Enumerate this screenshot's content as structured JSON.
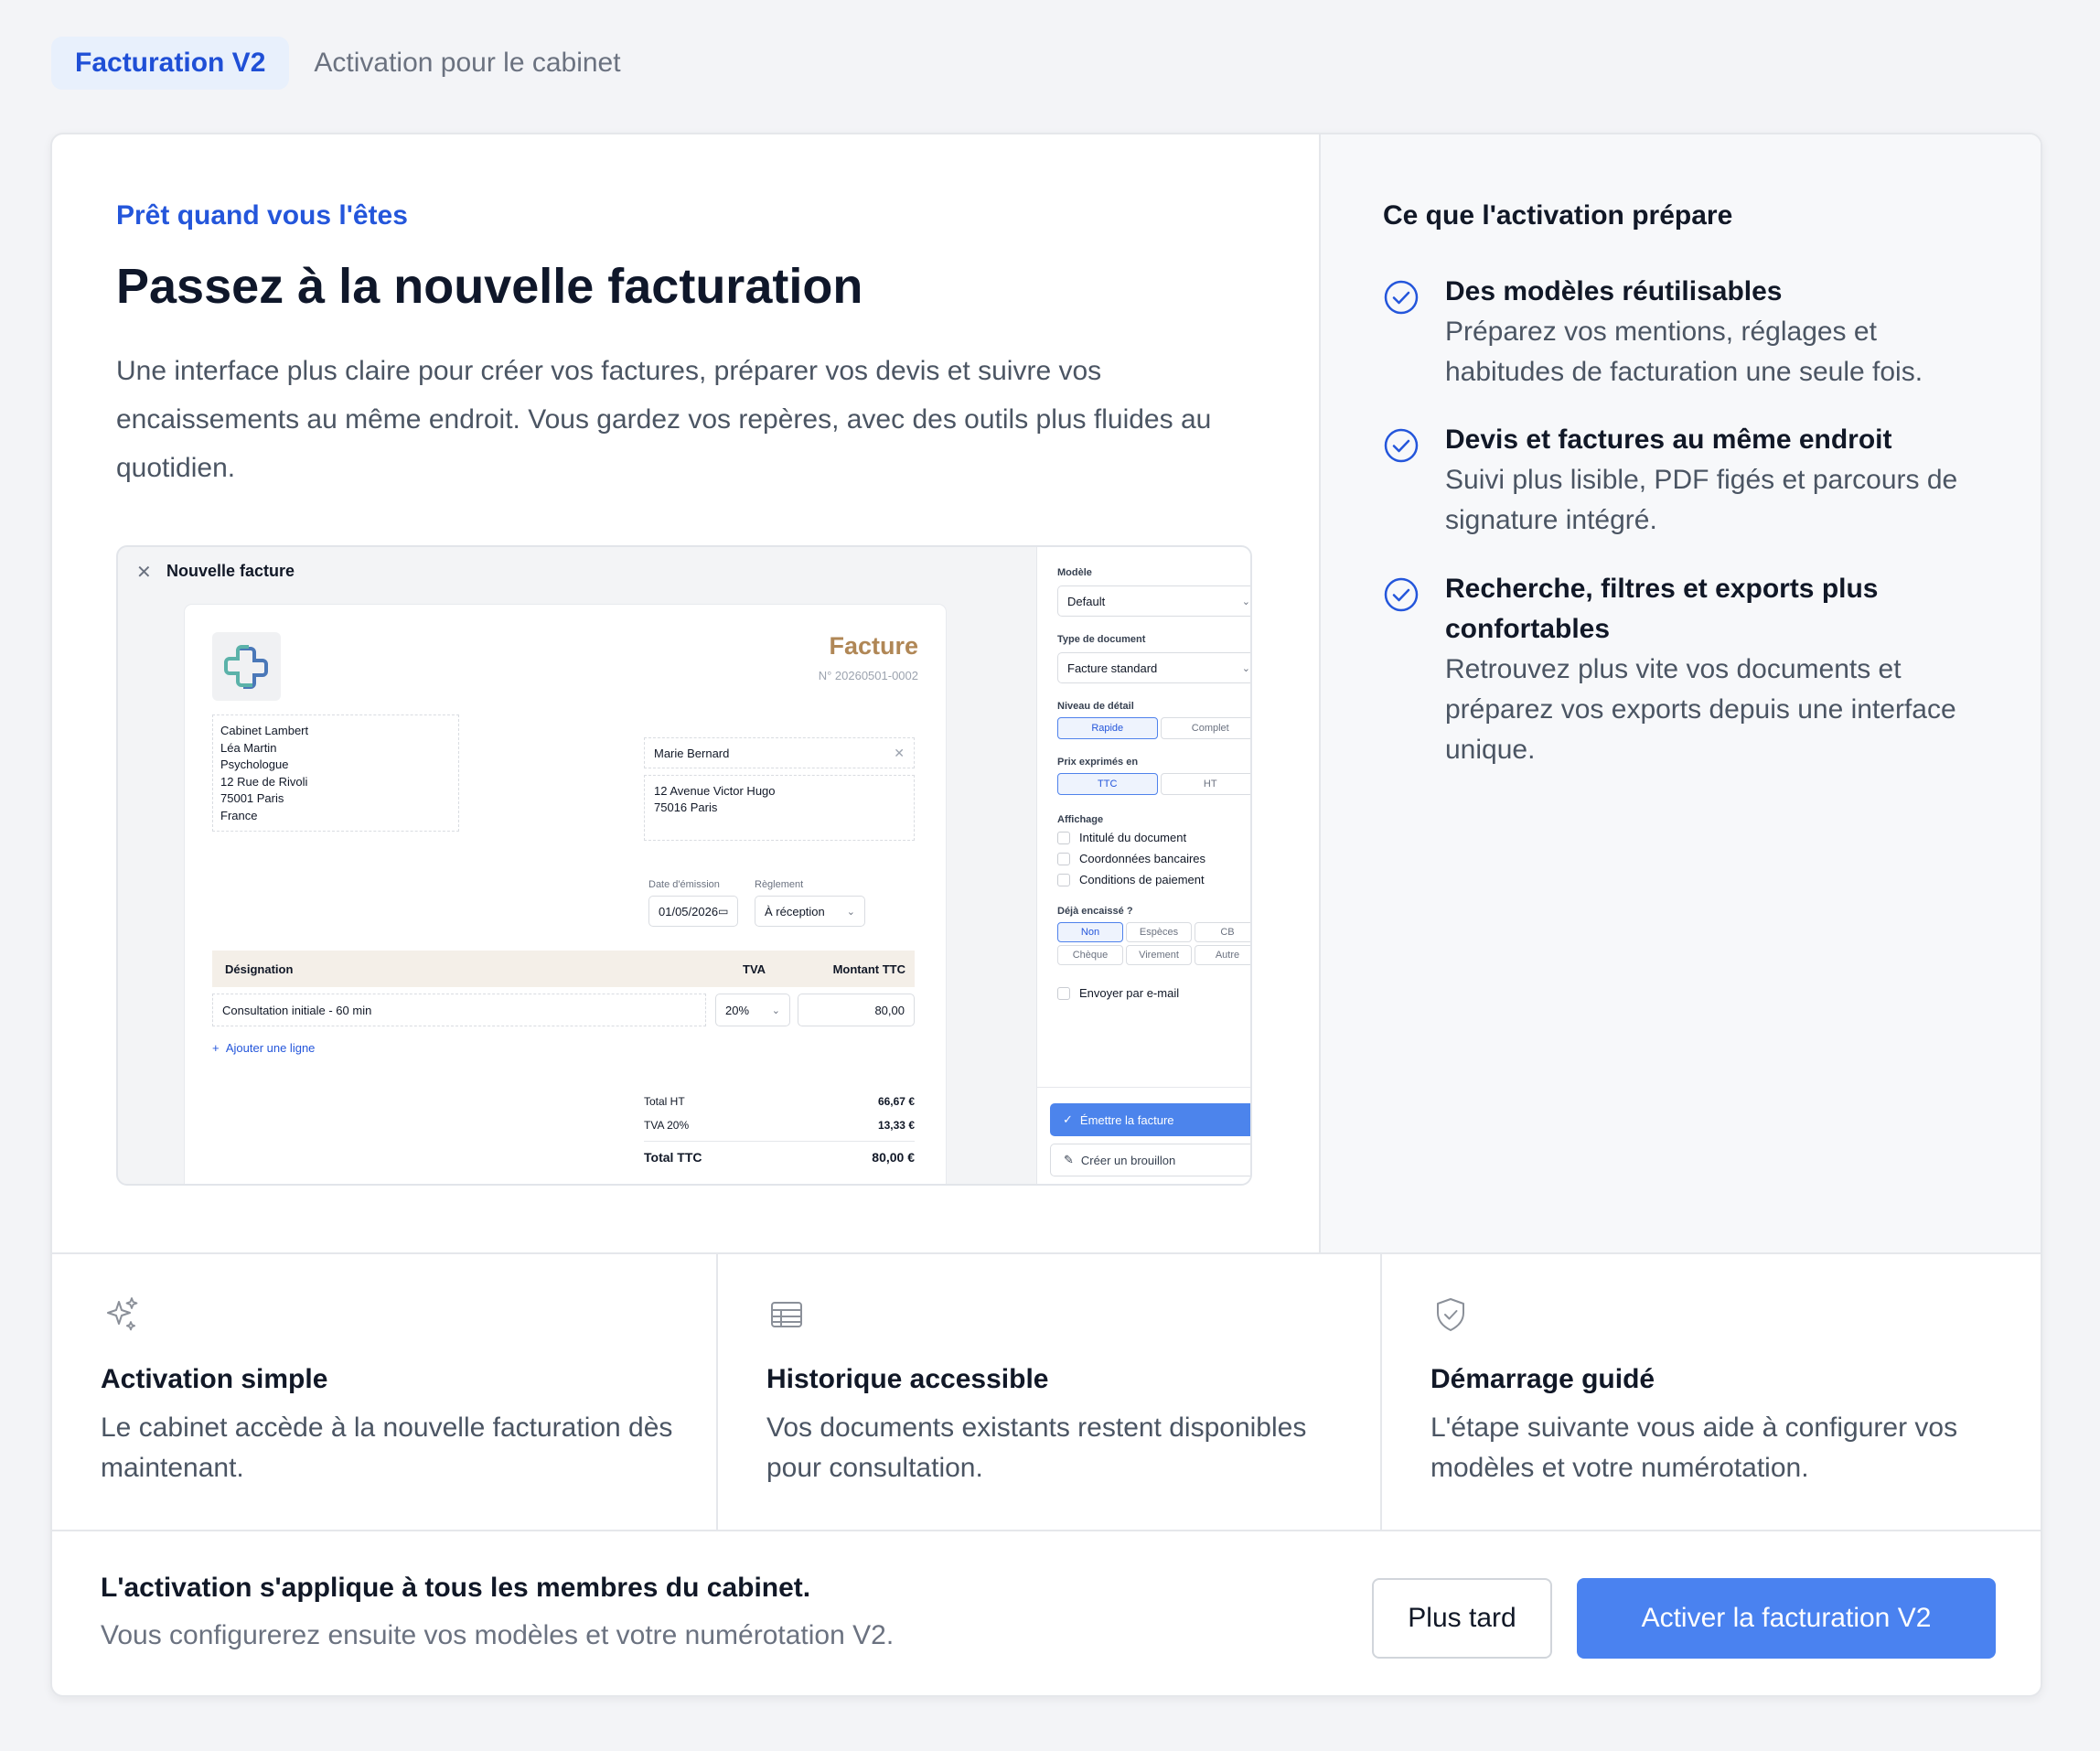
{
  "tabs": {
    "active": "Facturation V2",
    "inactive": "Activation pour le cabinet"
  },
  "hero": {
    "eyebrow": "Prêt quand vous l'êtes",
    "title": "Passez à la nouvelle facturation",
    "description": "Une interface plus claire pour créer vos factures, préparer vos devis et suivre vos encaissements au même endroit. Vous gardez vos repères, avec des outils plus fluides au quotidien."
  },
  "preview": {
    "window_title": "Nouvelle facture",
    "doc_heading": "Facture",
    "doc_number": "N° 20260501-0002",
    "issuer_lines": [
      "Cabinet Lambert",
      "Léa Martin",
      "Psychologue",
      "12 Rue de Rivoli",
      "75001 Paris",
      "France"
    ],
    "client_name": "Marie Bernard",
    "client_address_lines": [
      "12 Avenue Victor Hugo",
      "75016 Paris"
    ],
    "date_label": "Date d'émission",
    "date_value": "01/05/2026",
    "payment_label": "Règlement",
    "payment_value": "À réception",
    "table_headers": {
      "designation": "Désignation",
      "tva": "TVA",
      "amount": "Montant TTC"
    },
    "line": {
      "designation": "Consultation initiale - 60 min",
      "tva": "20%",
      "amount": "80,00"
    },
    "add_line": "Ajouter une ligne",
    "totals": {
      "ht_label": "Total HT",
      "ht_value": "66,67 €",
      "tva_label": "TVA 20%",
      "tva_value": "13,33 €",
      "ttc_label": "Total TTC",
      "ttc_value": "80,00 €"
    },
    "panel": {
      "model_label": "Modèle",
      "model_value": "Default",
      "doctype_label": "Type de document",
      "doctype_value": "Facture standard",
      "detail_label": "Niveau de détail",
      "detail_options": [
        "Rapide",
        "Complet"
      ],
      "prices_label": "Prix exprimés en",
      "prices_options": [
        "TTC",
        "HT"
      ],
      "display_label": "Affichage",
      "display_options": [
        "Intitulé du document",
        "Coordonnées bancaires",
        "Conditions de paiement"
      ],
      "cashed_label": "Déjà encaissé ?",
      "cashed_options": [
        "Non",
        "Espèces",
        "CB",
        "Chèque",
        "Virement",
        "Autre"
      ],
      "email_label": "Envoyer par e-mail",
      "issue_button": "Émettre la facture",
      "draft_button": "Créer un brouillon"
    }
  },
  "aside": {
    "title": "Ce que l'activation prépare",
    "items": [
      {
        "title": "Des modèles réutilisables",
        "text": "Préparez vos mentions, réglages et habitudes de facturation une seule fois."
      },
      {
        "title": "Devis et factures au même endroit",
        "text": "Suivi plus lisible, PDF figés et parcours de signature intégré."
      },
      {
        "title": "Recherche, filtres et exports plus confortables",
        "text": "Retrouvez plus vite vos documents et préparez vos exports depuis une interface unique."
      }
    ]
  },
  "features": [
    {
      "icon": "sparkles-icon",
      "title": "Activation simple",
      "text": "Le cabinet accède à la nouvelle facturation dès maintenant."
    },
    {
      "icon": "table-icon",
      "title": "Historique accessible",
      "text": "Vos documents existants restent disponibles pour consultation."
    },
    {
      "icon": "shield-check-icon",
      "title": "Démarrage guidé",
      "text": "L'étape suivante vous aide à configurer vos modèles et votre numérotation."
    }
  ],
  "footer": {
    "title": "L'activation s'applique à tous les membres du cabinet.",
    "subtitle": "Vous configurerez ensuite vos modèles et votre numérotation V2.",
    "later_button": "Plus tard",
    "activate_button": "Activer la facturation V2"
  },
  "colors": {
    "accent": "#2456db",
    "primary_button": "#4a82f0",
    "facture_heading": "#b08756"
  }
}
